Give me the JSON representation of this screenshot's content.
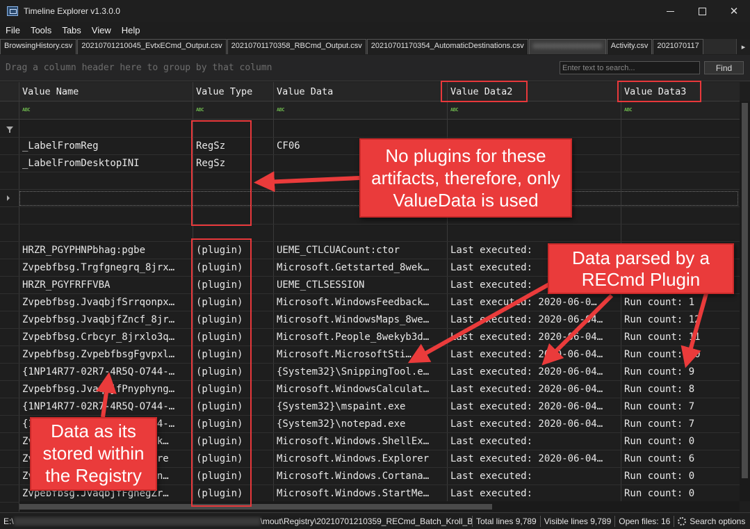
{
  "window": {
    "title": "Timeline Explorer v1.3.0.0",
    "minimize": "",
    "maximize": "",
    "close": "✕"
  },
  "menu": [
    "File",
    "Tools",
    "Tabs",
    "View",
    "Help"
  ],
  "tabs": [
    "BrowsingHistory.csv",
    "20210701210045_EvtxECmd_Output.csv",
    "20210701170358_RBCmd_Output.csv",
    "20210701170354_AutomaticDestinations.csv",
    "Activity.csv",
    "2021070117"
  ],
  "tab_scroll_icon": "▸",
  "group_panel": {
    "hint": "Drag a column header here to group by that column",
    "search_placeholder": "Enter text to search...",
    "find_label": "Find"
  },
  "columns": [
    "Value Name",
    "Value Type",
    "Value Data",
    "Value Data2",
    "Value Data3"
  ],
  "filter_icon_text": "ABC",
  "rows": [
    {
      "name": "",
      "type": "",
      "data": "",
      "data2": "",
      "data3": ""
    },
    {
      "name": "_LabelFromReg",
      "type": "RegSz",
      "data": "CF06",
      "data2": "",
      "data3": ""
    },
    {
      "name": "_LabelFromDesktopINI",
      "type": "RegSz",
      "data": "",
      "data2": "",
      "data3": ""
    },
    {
      "name": "",
      "type": "",
      "data": "",
      "data2": "",
      "data3": ""
    },
    {
      "name": "",
      "type": "",
      "data": "",
      "data2": "",
      "data3": ""
    },
    {
      "name": "",
      "type": "",
      "data": "",
      "data2": "",
      "data3": ""
    },
    {
      "name": "",
      "type": "",
      "data": "",
      "data2": "",
      "data3": ""
    },
    {
      "name": "HRZR_PGYPHNPbhag:pgbe",
      "type": "(plugin)",
      "data": "UEME_CTLCUACount:ctor",
      "data2": "Last executed:",
      "data3": ""
    },
    {
      "name": "Zvpebfbsg.Trgfgnegrq_8jrx…",
      "type": "(plugin)",
      "data": "Microsoft.Getstarted_8wek…",
      "data2": "Last executed:",
      "data3": ""
    },
    {
      "name": "HRZR_PGYFRFFVBA",
      "type": "(plugin)",
      "data": "UEME_CTLSESSION",
      "data2": "Last executed:",
      "data3": ""
    },
    {
      "name": "Zvpebfbsg.JvaqbjfSrrqonpx…",
      "type": "(plugin)",
      "data": "Microsoft.WindowsFeedback…",
      "data2": "Last executed: 2020-06-0…",
      "data3": "Run count: 1"
    },
    {
      "name": "Zvpebfbsg.JvaqbjfZncf_8jr…",
      "type": "(plugin)",
      "data": "Microsoft.WindowsMaps_8we…",
      "data2": "Last executed: 2020-06-04…",
      "data3": "Run count: 12"
    },
    {
      "name": "Zvpebfbsg.Crbcyr_8jrxlo3q…",
      "type": "(plugin)",
      "data": "Microsoft.People_8wekyb3d…",
      "data2": "Last executed: 2020-06-04…",
      "data3": "Run count: 11"
    },
    {
      "name": "Zvpebfbsg.ZvpebfbsgFgvpxl…",
      "type": "(plugin)",
      "data": "Microsoft.MicrosoftSti…",
      "data2": "Last executed: 2020-06-04…",
      "data3": "Run count: 10"
    },
    {
      "name": "{1NP14R77-02R7-4R5Q-O744-…",
      "type": "(plugin)",
      "data": "{System32}\\SnippingTool.e…",
      "data2": "Last executed: 2020-06-04…",
      "data3": "Run count: 9"
    },
    {
      "name": "Zvpebfbsg.JvaqbjfPnyphyng…",
      "type": "(plugin)",
      "data": "Microsoft.WindowsCalculat…",
      "data2": "Last executed: 2020-06-04…",
      "data3": "Run count: 8"
    },
    {
      "name": "{1NP14R77-02R7-4R5Q-O744-…",
      "type": "(plugin)",
      "data": "{System32}\\mspaint.exe",
      "data2": "Last executed: 2020-06-04…",
      "data3": "Run count: 7"
    },
    {
      "name": "{1NP14R77-02R7-4R5Q-O744-…",
      "type": "(plugin)",
      "data": "{System32}\\notepad.exe",
      "data2": "Last executed: 2020-06-04…",
      "data3": "Run count: 7"
    },
    {
      "name": "Zvpebfbsg.JvaqbjfFuryyRk…",
      "type": "(plugin)",
      "data": "Microsoft.Windows.ShellEx…",
      "data2": "Last executed:",
      "data3": "Run count: 0"
    },
    {
      "name": "Zvpebfbsg.JvaqbjfRkcybere",
      "type": "(plugin)",
      "data": "Microsoft.Windows.Explorer",
      "data2": "Last executed: 2020-06-04…",
      "data3": "Run count: 6"
    },
    {
      "name": "Zvpebfbsg.JvaqbjfPbegnan…",
      "type": "(plugin)",
      "data": "Microsoft.Windows.Cortana…",
      "data2": "Last executed:",
      "data3": "Run count: 0"
    },
    {
      "name": "Zvpebfbsg.JvaqbjfFgnegZr…",
      "type": "(plugin)",
      "data": "Microsoft.Windows.StartMe…",
      "data2": "Last executed:",
      "data3": "Run count: 0"
    }
  ],
  "status": {
    "path_prefix": "E:\\",
    "path_suffix": "\\mout\\Registry\\20210701210359_RECmd_Batch_Kroll_Batch",
    "total_lines": "Total lines 9,789",
    "visible_lines": "Visible lines 9,789",
    "open_files": "Open files: 16",
    "search_options": "Search options"
  },
  "annotations": {
    "no_plugins": [
      "No plugins for these",
      "artifacts, therefore, only",
      "ValueData is used"
    ],
    "parsed": [
      "Data parsed by a",
      "RECmd Plugin"
    ],
    "stored": [
      "Data as its",
      "stored within",
      "the Registry"
    ],
    "color": "#ea3b3b"
  }
}
